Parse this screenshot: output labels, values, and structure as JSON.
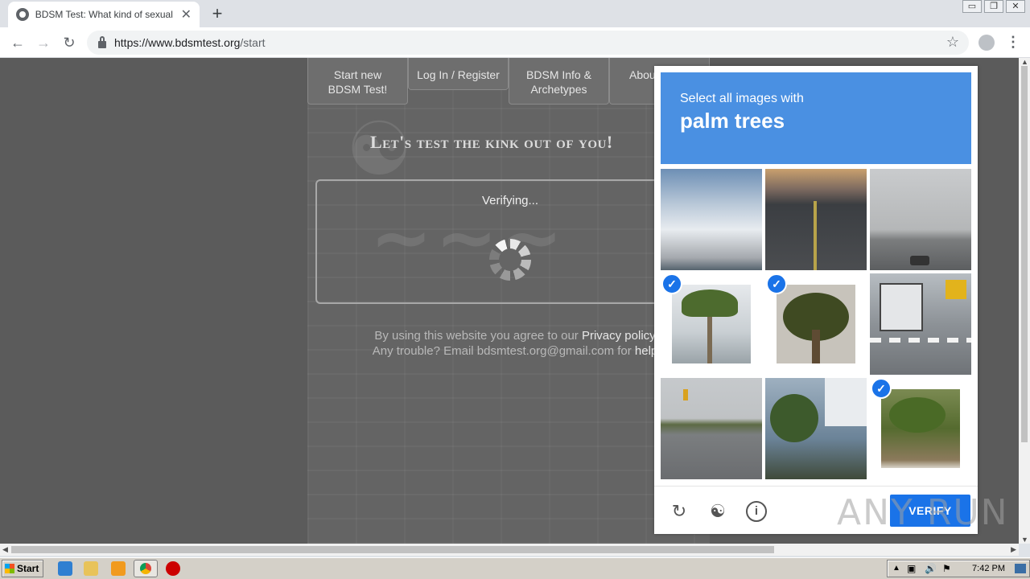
{
  "browser": {
    "tab_title": "BDSM Test: What kind of sexual deviant are you?",
    "tab_close": "✕",
    "new_tab": "+",
    "url_host": "https://www.bdsmtest.org",
    "url_path": "/start",
    "window_controls": [
      "▭",
      "❐",
      "✕"
    ]
  },
  "site": {
    "nav": [
      {
        "label": "Start new BDSM Test!"
      },
      {
        "label": "Log In / Register"
      },
      {
        "label": "BDSM Info & Archetypes"
      },
      {
        "label": "About / Co"
      }
    ],
    "headline": "Let's test the kink out of you!",
    "verifying": "Verifying...",
    "consent_line1_prefix": "By using this website you agree to our ",
    "consent_line1_link": "Privacy policy",
    "consent_line2_prefix": "Any trouble? Email bdsmtest.org@gmail.com for ",
    "consent_line2_link": "help"
  },
  "captcha": {
    "instruction": "Select all images with",
    "target": "palm trees",
    "verify_label": "VERIFY",
    "tiles": [
      {
        "name": "cloudy-sky",
        "selected": false
      },
      {
        "name": "highway-dusk",
        "selected": false
      },
      {
        "name": "highway-overcast",
        "selected": false
      },
      {
        "name": "palm-tree-street",
        "selected": true
      },
      {
        "name": "palm-tree-close",
        "selected": true
      },
      {
        "name": "city-bus",
        "selected": false
      },
      {
        "name": "road-traffic-light",
        "selected": false
      },
      {
        "name": "building-palms",
        "selected": false
      },
      {
        "name": "palm-shrubs",
        "selected": true
      }
    ],
    "footer_icons": [
      "reload-icon",
      "audio-icon",
      "info-icon"
    ],
    "colors": {
      "header": "#4a90e2",
      "button": "#1a73e8"
    }
  },
  "watermark": "ANY RUN",
  "taskbar": {
    "start": "Start",
    "clock": "7:42 PM"
  }
}
